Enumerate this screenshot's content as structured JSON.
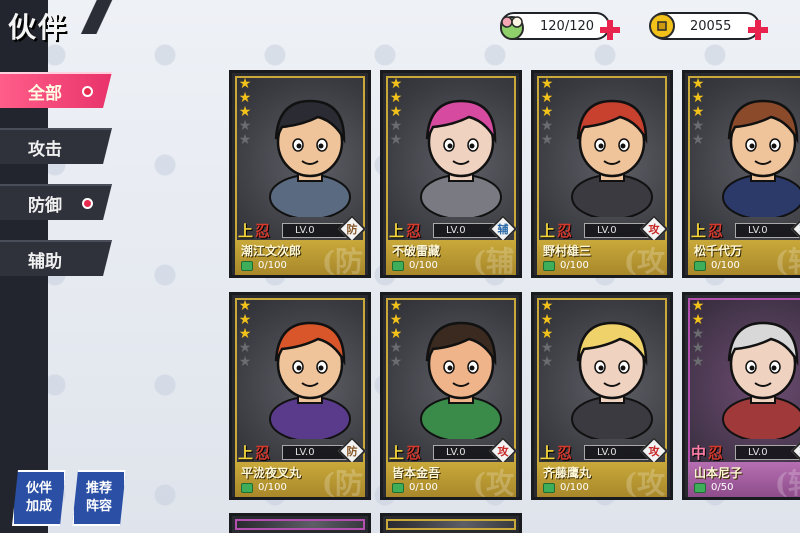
{
  "title": "伙伴",
  "tabs": [
    {
      "label": "全部",
      "active": true,
      "dot": true
    },
    {
      "label": "攻击",
      "active": false,
      "dot": false
    },
    {
      "label": "防御",
      "active": false,
      "dot": true
    },
    {
      "label": "辅助",
      "active": false,
      "dot": false
    }
  ],
  "bottom_buttons": [
    {
      "line1": "伙伴",
      "line2": "加成"
    },
    {
      "line1": "推荐",
      "line2": "阵容"
    }
  ],
  "currency": {
    "stamina": {
      "value": "120/120",
      "icon": "dumpling-icon"
    },
    "coins": {
      "value": "20055",
      "icon": "coin-icon"
    }
  },
  "cards": [
    {
      "name": "潮江文次郎",
      "rank1": "上",
      "rank2": "忍",
      "level": "LV.0",
      "type": "防",
      "watermark": "(防",
      "fragments": "0/100",
      "stars": 3,
      "frame": "gold",
      "palette": [
        "#2b2b33",
        "#f0c49a",
        "#5a6a80"
      ]
    },
    {
      "name": "不破雷藏",
      "rank1": "上",
      "rank2": "忍",
      "level": "LV.0",
      "type": "辅",
      "watermark": "(辅",
      "fragments": "0/100",
      "stars": 3,
      "frame": "gold",
      "palette": [
        "#d64aa0",
        "#f0d2c0",
        "#7a7a82"
      ]
    },
    {
      "name": "野村雄三",
      "rank1": "上",
      "rank2": "忍",
      "level": "LV.0",
      "type": "攻",
      "watermark": "(攻",
      "fragments": "0/100",
      "stars": 3,
      "frame": "gold",
      "palette": [
        "#c8402e",
        "#f0c49a",
        "#3a3a40"
      ]
    },
    {
      "name": "松千代万",
      "rank1": "上",
      "rank2": "忍",
      "level": "LV.0",
      "type": "辅",
      "watermark": "(辅",
      "fragments": "0/100",
      "stars": 3,
      "frame": "gold",
      "palette": [
        "#8b4a2a",
        "#f0c49a",
        "#2c3a6a"
      ]
    },
    {
      "name": "平泷夜叉丸",
      "rank1": "上",
      "rank2": "忍",
      "level": "LV.0",
      "type": "防",
      "watermark": "(防",
      "fragments": "0/100",
      "stars": 3,
      "frame": "gold",
      "palette": [
        "#d8562a",
        "#f0c49a",
        "#5a3a8a"
      ]
    },
    {
      "name": "皆本金吾",
      "rank1": "上",
      "rank2": "忍",
      "level": "LV.0",
      "type": "攻",
      "watermark": "(攻",
      "fragments": "0/100",
      "stars": 3,
      "frame": "gold",
      "palette": [
        "#3a2a20",
        "#f0b48a",
        "#3a8a4a"
      ]
    },
    {
      "name": "齐藤鹰丸",
      "rank1": "上",
      "rank2": "忍",
      "level": "LV.0",
      "type": "攻",
      "watermark": "(攻",
      "fragments": "0/100",
      "stars": 3,
      "frame": "gold",
      "palette": [
        "#f0d26a",
        "#f0d2c0",
        "#3a3a40"
      ]
    },
    {
      "name": "山本尼子",
      "rank1": "中",
      "rank2": "忍",
      "level": "LV.0",
      "type": "辅",
      "watermark": "(辅",
      "fragments": "0/50",
      "stars": 2,
      "frame": "purple",
      "palette": [
        "#d8d8d8",
        "#f0d2c0",
        "#a03a3a"
      ]
    }
  ]
}
